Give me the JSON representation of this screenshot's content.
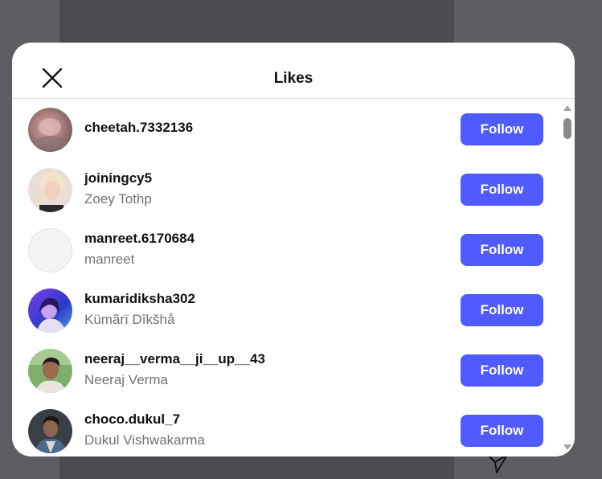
{
  "modal": {
    "title": "Likes",
    "close_icon": "close-icon"
  },
  "likes": [
    {
      "username": "cheetah.7332136",
      "fullname": "",
      "button": "Follow",
      "avatar": "blurred-photo"
    },
    {
      "username": "joiningcy5",
      "fullname": "Zoey Tothp",
      "button": "Follow",
      "avatar": "photo-blonde-woman"
    },
    {
      "username": "manreet.6170684",
      "fullname": "manreet",
      "button": "Follow",
      "avatar": "empty-placeholder"
    },
    {
      "username": "kumaridiksha302",
      "fullname": "Kümãrï Dîkšhå",
      "button": "Follow",
      "avatar": "photo-purple-tint"
    },
    {
      "username": "neeraj__verma__ji__up__43",
      "fullname": "Neeraj Verma",
      "button": "Follow",
      "avatar": "photo-man-outdoors"
    },
    {
      "username": "choco.dukul_7",
      "fullname": "Dukul Vishwakarma",
      "button": "Follow",
      "avatar": "photo-man-dark"
    }
  ],
  "colors": {
    "follow_button": "#4f5bff",
    "overlay": "#4a4c4f",
    "secondary_text": "#737373"
  }
}
